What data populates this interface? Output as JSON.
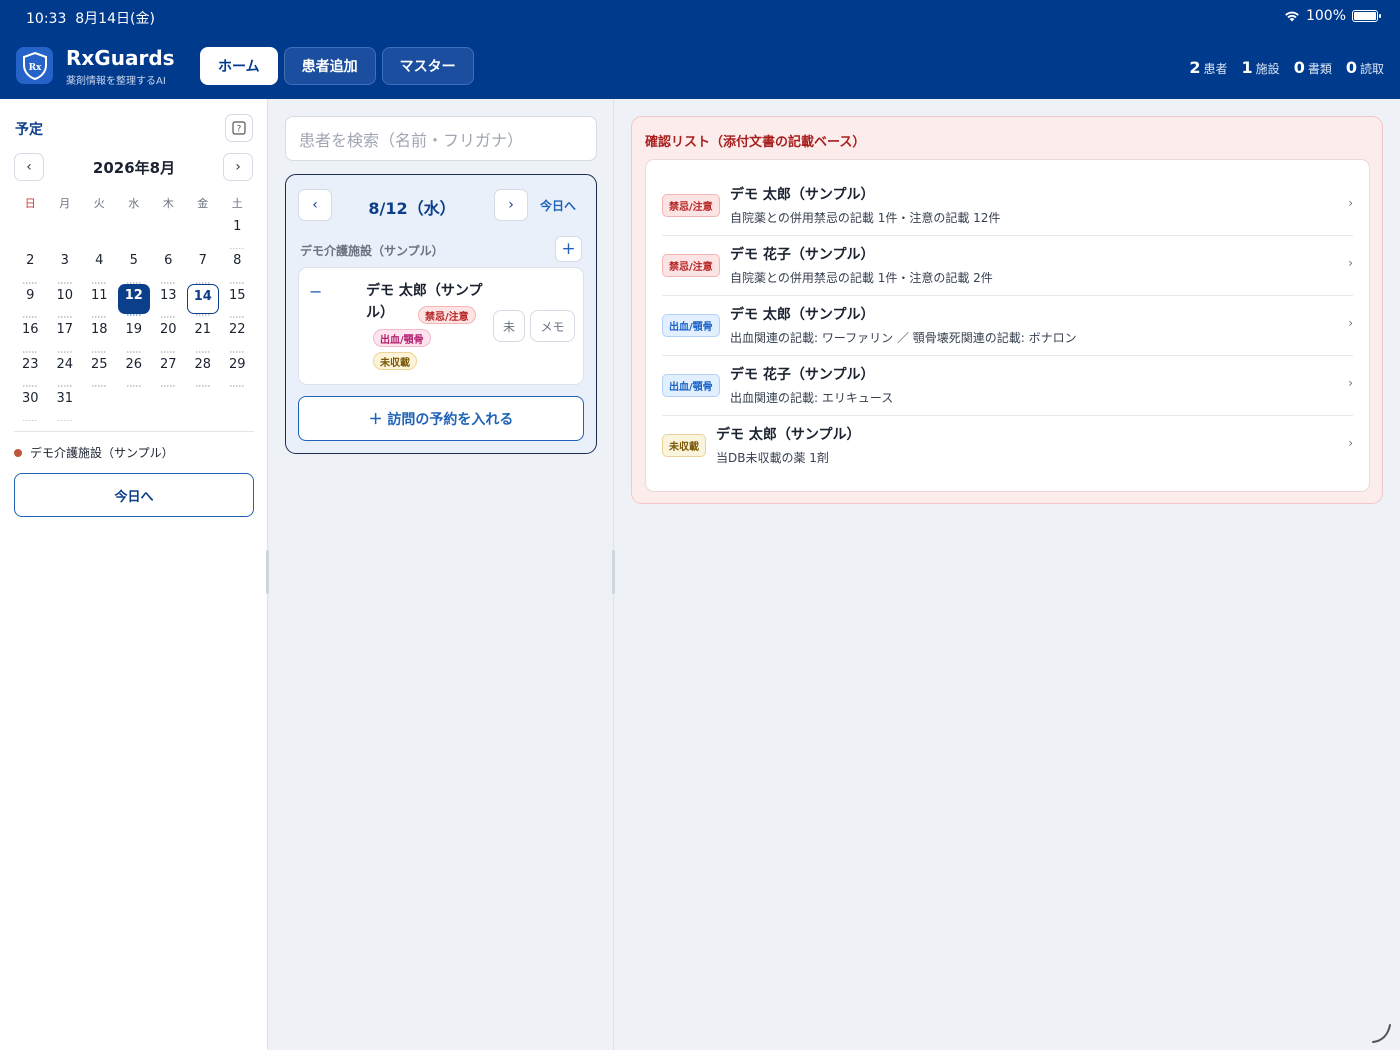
{
  "status": {
    "time": "10:33",
    "date": "8月14日(金)",
    "battery": "100%"
  },
  "app": {
    "title": "RxGuards",
    "subtitle": "薬剤情報を整理するAI",
    "logo_text": "Rx"
  },
  "nav": {
    "home": "ホーム",
    "add_patient": "患者追加",
    "master": "マスター"
  },
  "stats": [
    {
      "num": "2",
      "label": "患者"
    },
    {
      "num": "1",
      "label": "施設"
    },
    {
      "num": "0",
      "label": "書類"
    },
    {
      "num": "0",
      "label": "読取"
    }
  ],
  "sidebar": {
    "title": "予定",
    "month": "2026年8月",
    "prev": "‹",
    "next": "›",
    "weekdays": [
      "日",
      "月",
      "火",
      "水",
      "木",
      "金",
      "土"
    ],
    "days": [
      "",
      "",
      "",
      "",
      "",
      "",
      "1",
      "2",
      "3",
      "4",
      "5",
      "6",
      "7",
      "8",
      "9",
      "10",
      "11",
      "12",
      "13",
      "14",
      "15",
      "16",
      "17",
      "18",
      "19",
      "20",
      "21",
      "22",
      "23",
      "24",
      "25",
      "26",
      "27",
      "28",
      "29",
      "30",
      "31"
    ],
    "selected_day": "12",
    "today_day": "14",
    "legend_facility": "デモ介護施設（サンプル）",
    "legend_color": "#c0563c",
    "today_button": "今日へ"
  },
  "search": {
    "placeholder": "患者を検索（名前・フリガナ）"
  },
  "day_panel": {
    "prev": "‹",
    "next": "›",
    "date": "8/12（水）",
    "today_link": "今日へ",
    "facility": "デモ介護施設（サンプル）",
    "add": "+",
    "patient": {
      "toggle": "−",
      "name": "デモ 太郎（サンプル）",
      "tags": [
        "禁忌/注意",
        "出血/顎骨",
        "未収載"
      ],
      "status_btn": "未",
      "memo_btn": "メモ"
    },
    "visit_button": "＋ 訪問の予約を入れる"
  },
  "check_list": {
    "title": "確認リスト（添付文書の記載ベース）",
    "items": [
      {
        "badge": "禁忌/注意",
        "name": "デモ 太郎（サンプル）",
        "desc": "自院薬との併用禁忌の記載 1件・注意の記載 12件"
      },
      {
        "badge": "禁忌/注意",
        "name": "デモ 花子（サンプル）",
        "desc": "自院薬との併用禁忌の記載 1件・注意の記載 2件"
      },
      {
        "badge": "出血/顎骨",
        "name": "デモ 太郎（サンプル）",
        "desc": "出血関連の記載: ワーファリン ／ 顎骨壊死関連の記載: ボナロン"
      },
      {
        "badge": "出血/顎骨",
        "name": "デモ 花子（サンプル）",
        "desc": "出血関連の記載: エリキュース"
      },
      {
        "badge": "未収載",
        "name": "デモ 太郎（サンプル）",
        "desc": "当DB未収載の薬 1剤"
      }
    ],
    "chevron": "›"
  },
  "colors": {
    "header_bg": "#003a8c",
    "accent": "#1f63b8",
    "contra": "#b42323",
    "bleed": "#1b63c8",
    "unlisted": "#7a5a09"
  }
}
